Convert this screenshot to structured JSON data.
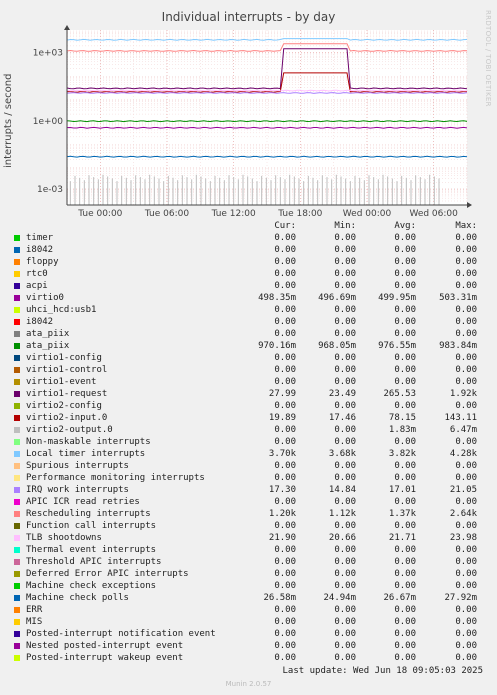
{
  "chart_data": {
    "type": "line",
    "title": "Individual interrupts - by day",
    "side_label": "RRDTOOL / TOBI OETIKER",
    "ylabel": "interrupts / second",
    "yscale": "log",
    "ylim": [
      0.0002,
      10000
    ],
    "y_ticks": [
      "1e+03",
      "1e+00",
      "1e-03"
    ],
    "x_ticks": [
      "Tue 00:00",
      "Tue 06:00",
      "Tue 12:00",
      "Tue 18:00",
      "Wed 00:00",
      "Wed 06:00"
    ],
    "xlim_hours": [
      -3,
      33
    ],
    "grid": true,
    "columns": [
      "Cur:",
      "Min:",
      "Avg:",
      "Max:"
    ],
    "series": [
      {
        "name": "timer",
        "color": "#00cc00",
        "cur": "0.00",
        "min": "0.00",
        "avg": "0.00",
        "max": "0.00",
        "level": 0
      },
      {
        "name": "i8042",
        "color": "#0066b3",
        "cur": "0.00",
        "min": "0.00",
        "avg": "0.00",
        "max": "0.00",
        "level": 0
      },
      {
        "name": "floppy",
        "color": "#ff8000",
        "cur": "0.00",
        "min": "0.00",
        "avg": "0.00",
        "max": "0.00",
        "level": 0
      },
      {
        "name": "rtc0",
        "color": "#ffcc00",
        "cur": "0.00",
        "min": "0.00",
        "avg": "0.00",
        "max": "0.00",
        "level": 0
      },
      {
        "name": "acpi",
        "color": "#330099",
        "cur": "0.00",
        "min": "0.00",
        "avg": "0.00",
        "max": "0.00",
        "level": 0
      },
      {
        "name": "virtio0",
        "color": "#990099",
        "cur": "498.35m",
        "min": "496.69m",
        "avg": "499.95m",
        "max": "503.31m",
        "level": 0.4999
      },
      {
        "name": "uhci_hcd:usb1",
        "color": "#ccff00",
        "cur": "0.00",
        "min": "0.00",
        "avg": "0.00",
        "max": "0.00",
        "level": 0
      },
      {
        "name": "i8042",
        "color": "#ff0000",
        "cur": "0.00",
        "min": "0.00",
        "avg": "0.00",
        "max": "0.00",
        "level": 0
      },
      {
        "name": "ata_piix",
        "color": "#808080",
        "cur": "0.00",
        "min": "0.00",
        "avg": "0.00",
        "max": "0.00",
        "level": 0
      },
      {
        "name": "ata_piix",
        "color": "#008f00",
        "cur": "970.16m",
        "min": "968.05m",
        "avg": "976.55m",
        "max": "983.84m",
        "level": 0.9765
      },
      {
        "name": "virtio1-config",
        "color": "#00487d",
        "cur": "0.00",
        "min": "0.00",
        "avg": "0.00",
        "max": "0.00",
        "level": 0
      },
      {
        "name": "virtio1-control",
        "color": "#b35a00",
        "cur": "0.00",
        "min": "0.00",
        "avg": "0.00",
        "max": "0.00",
        "level": 0
      },
      {
        "name": "virtio1-event",
        "color": "#b38f00",
        "cur": "0.00",
        "min": "0.00",
        "avg": "0.00",
        "max": "0.00",
        "level": 0
      },
      {
        "name": "virtio1-request",
        "color": "#6b006b",
        "cur": "27.99",
        "min": "23.49",
        "avg": "265.53",
        "max": "1.92k",
        "level": 27
      },
      {
        "name": "virtio2-config",
        "color": "#8fb300",
        "cur": "0.00",
        "min": "0.00",
        "avg": "0.00",
        "max": "0.00",
        "level": 0
      },
      {
        "name": "virtio2-input.0",
        "color": "#b30000",
        "cur": "19.89",
        "min": "17.46",
        "avg": "78.15",
        "max": "143.11",
        "level": 19
      },
      {
        "name": "virtio2-output.0",
        "color": "#bebebe",
        "cur": "0.00",
        "min": "0.00",
        "avg": "1.83m",
        "max": "6.47m",
        "level": 0
      },
      {
        "name": "Non-maskable interrupts",
        "color": "#80ff80",
        "cur": "0.00",
        "min": "0.00",
        "avg": "0.00",
        "max": "0.00",
        "level": 0
      },
      {
        "name": "Local timer interrupts",
        "color": "#80c9ff",
        "cur": "3.70k",
        "min": "3.68k",
        "avg": "3.82k",
        "max": "4.28k",
        "level": 3700
      },
      {
        "name": "Spurious interrupts",
        "color": "#ffc080",
        "cur": "0.00",
        "min": "0.00",
        "avg": "0.00",
        "max": "0.00",
        "level": 0
      },
      {
        "name": "Performance monitoring interrupts",
        "color": "#ffe680",
        "cur": "0.00",
        "min": "0.00",
        "avg": "0.00",
        "max": "0.00",
        "level": 0
      },
      {
        "name": "IRQ work interrupts",
        "color": "#aa80ff",
        "cur": "17.30",
        "min": "14.84",
        "avg": "17.01",
        "max": "21.05",
        "level": 17
      },
      {
        "name": "APIC ICR read retries",
        "color": "#ee00cc",
        "cur": "0.00",
        "min": "0.00",
        "avg": "0.00",
        "max": "0.00",
        "level": 0
      },
      {
        "name": "Rescheduling interrupts",
        "color": "#ff8080",
        "cur": "1.20k",
        "min": "1.12k",
        "avg": "1.37k",
        "max": "2.64k",
        "level": 1200
      },
      {
        "name": "Function call interrupts",
        "color": "#666600",
        "cur": "0.00",
        "min": "0.00",
        "avg": "0.00",
        "max": "0.00",
        "level": 0
      },
      {
        "name": "TLB shootdowns",
        "color": "#ffbfff",
        "cur": "21.90",
        "min": "20.66",
        "avg": "21.71",
        "max": "23.98",
        "level": 21.7
      },
      {
        "name": "Thermal event interrupts",
        "color": "#00ffcc",
        "cur": "0.00",
        "min": "0.00",
        "avg": "0.00",
        "max": "0.00",
        "level": 0
      },
      {
        "name": "Threshold APIC interrupts",
        "color": "#cc6699",
        "cur": "0.00",
        "min": "0.00",
        "avg": "0.00",
        "max": "0.00",
        "level": 0
      },
      {
        "name": "Deferred Error APIC interrupts",
        "color": "#999900",
        "cur": "0.00",
        "min": "0.00",
        "avg": "0.00",
        "max": "0.00",
        "level": 0
      },
      {
        "name": "Machine check exceptions",
        "color": "#00cc00",
        "cur": "0.00",
        "min": "0.00",
        "avg": "0.00",
        "max": "0.00",
        "level": 0
      },
      {
        "name": "Machine check polls",
        "color": "#0066b3",
        "cur": "26.58m",
        "min": "24.94m",
        "avg": "26.67m",
        "max": "27.92m",
        "level": 0.0266
      },
      {
        "name": "ERR",
        "color": "#ff8000",
        "cur": "0.00",
        "min": "0.00",
        "avg": "0.00",
        "max": "0.00",
        "level": 0
      },
      {
        "name": "MIS",
        "color": "#ffcc00",
        "cur": "0.00",
        "min": "0.00",
        "avg": "0.00",
        "max": "0.00",
        "level": 0
      },
      {
        "name": "Posted-interrupt notification event",
        "color": "#330099",
        "cur": "0.00",
        "min": "0.00",
        "avg": "0.00",
        "max": "0.00",
        "level": 0
      },
      {
        "name": "Nested posted-interrupt event",
        "color": "#990099",
        "cur": "0.00",
        "min": "0.00",
        "avg": "0.00",
        "max": "0.00",
        "level": 0
      },
      {
        "name": "Posted-interrupt wakeup event",
        "color": "#ccff00",
        "cur": "0.00",
        "min": "0.00",
        "avg": "0.00",
        "max": "0.00",
        "level": 0
      }
    ],
    "burst": {
      "start_hour": 16.5,
      "end_hour": 22.2,
      "virtio1_request": 1500,
      "virtio2_input": 130,
      "local_timer": 4200,
      "rescheduling": 2500
    }
  },
  "last_update": "Last update: Wed Jun 18 09:05:03 2025",
  "version": "Munin 2.0.57"
}
